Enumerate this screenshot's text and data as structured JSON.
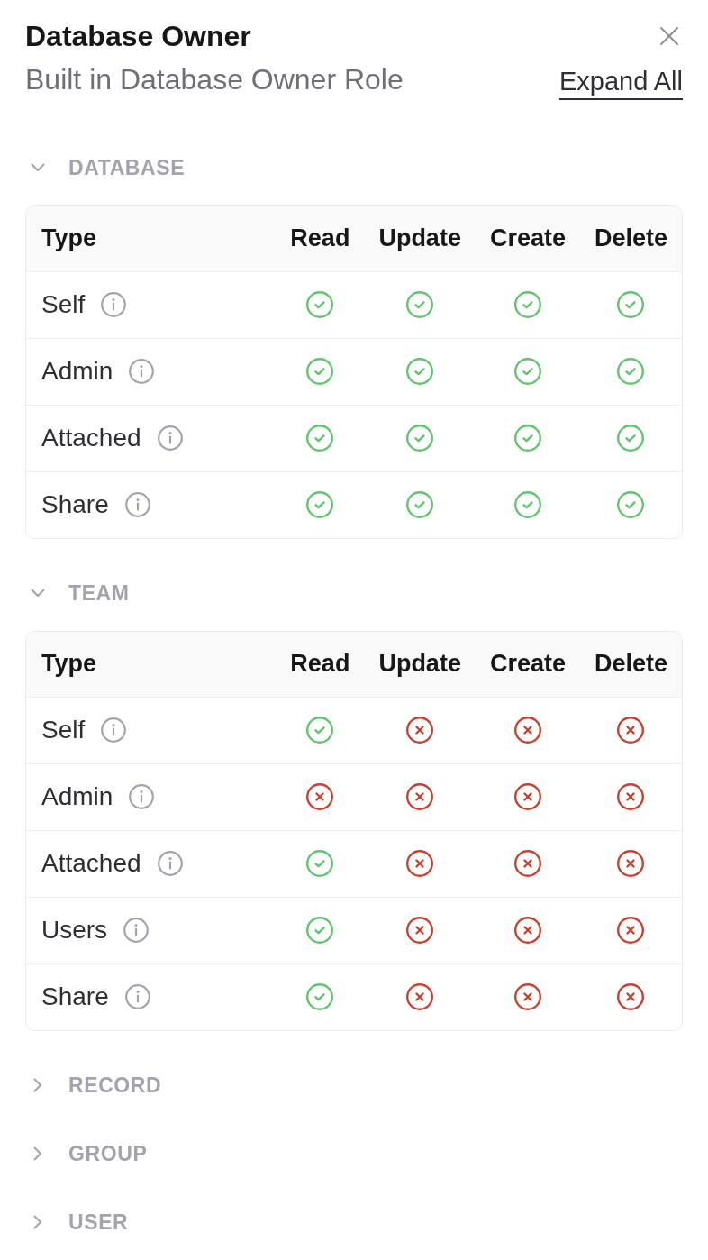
{
  "panel": {
    "title": "Database Owner",
    "subtitle": "Built in Database Owner Role",
    "expand_all": "Expand All"
  },
  "sections": [
    {
      "label": "DATABASE",
      "expanded": true,
      "columns": [
        "Type",
        "Read",
        "Update",
        "Create",
        "Delete"
      ],
      "rows": [
        {
          "type": "Self",
          "allowed": [
            true,
            true,
            true,
            true
          ]
        },
        {
          "type": "Admin",
          "allowed": [
            true,
            true,
            true,
            true
          ]
        },
        {
          "type": "Attached",
          "allowed": [
            true,
            true,
            true,
            true
          ]
        },
        {
          "type": "Share",
          "allowed": [
            true,
            true,
            true,
            true
          ]
        }
      ]
    },
    {
      "label": "TEAM",
      "expanded": true,
      "columns": [
        "Type",
        "Read",
        "Update",
        "Create",
        "Delete"
      ],
      "rows": [
        {
          "type": "Self",
          "allowed": [
            true,
            false,
            false,
            false
          ]
        },
        {
          "type": "Admin",
          "allowed": [
            false,
            false,
            false,
            false
          ]
        },
        {
          "type": "Attached",
          "allowed": [
            true,
            false,
            false,
            false
          ]
        },
        {
          "type": "Users",
          "allowed": [
            true,
            false,
            false,
            false
          ]
        },
        {
          "type": "Share",
          "allowed": [
            true,
            false,
            false,
            false
          ]
        }
      ]
    },
    {
      "label": "RECORD",
      "expanded": false
    },
    {
      "label": "GROUP",
      "expanded": false
    },
    {
      "label": "USER",
      "expanded": false
    }
  ]
}
